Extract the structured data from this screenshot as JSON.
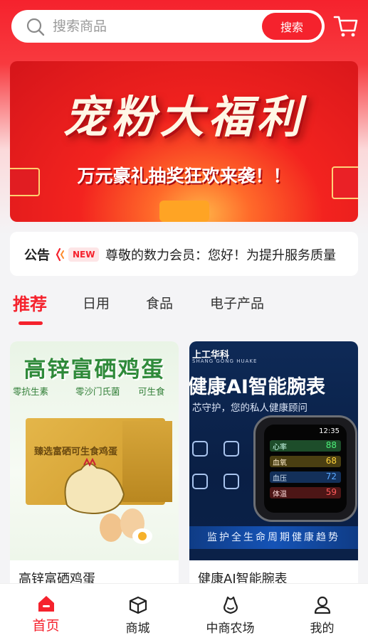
{
  "search": {
    "placeholder": "搜索商品",
    "button_label": "搜索",
    "icon": "search-icon"
  },
  "header": {
    "cart_icon": "cart-icon"
  },
  "banner": {
    "title": "宠粉大福利",
    "subtitle": "万元豪礼抽奖狂欢来袭！！"
  },
  "notice": {
    "label": "公告",
    "badge": "NEW",
    "text": "尊敬的数力会员：您好！为提升服务质量"
  },
  "tabs": [
    {
      "label": "推荐",
      "active": true
    },
    {
      "label": "日用"
    },
    {
      "label": "食品"
    },
    {
      "label": "电子产品"
    }
  ],
  "products": [
    {
      "title": "高锌富硒鸡蛋",
      "image": {
        "headline": "高锌富硒鸡蛋",
        "features": [
          "零抗生素",
          "零沙门氏菌",
          "可生食"
        ],
        "box_title": "臻选富硒可生食鸡蛋"
      }
    },
    {
      "title": "健康AI智能腕表",
      "image": {
        "brand": "上工华科",
        "brand_sub": "SHANG GONG HUAKE",
        "headline": "健康AI智能腕表",
        "tagline": "芯守护，您的私人健康顾问",
        "footer": "监护全生命周期健康趋势",
        "screen_rows": [
          {
            "label": "心率",
            "value": "88"
          },
          {
            "label": "血氧",
            "value": "68"
          },
          {
            "label": "血压",
            "value": "72"
          },
          {
            "label": "体温",
            "value": "59"
          }
        ],
        "screen_time": "12:35"
      }
    }
  ],
  "bottom_nav": [
    {
      "label": "首页",
      "icon": "home-icon",
      "active": true
    },
    {
      "label": "商城",
      "icon": "package-icon"
    },
    {
      "label": "中商农场",
      "icon": "farm-icon"
    },
    {
      "label": "我的",
      "icon": "user-icon"
    }
  ],
  "colors": {
    "accent": "#f5222d",
    "text": "#222222",
    "placeholder": "#9a9a9a"
  }
}
